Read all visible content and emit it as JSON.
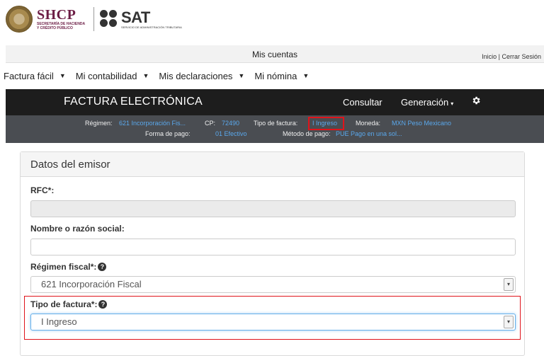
{
  "header": {
    "shcp_title": "SHCP",
    "shcp_subtitle_1": "SECRETARÍA DE HACIENDA",
    "shcp_subtitle_2": "Y CRÉDITO PÚBLICO",
    "sat_title": "SAT",
    "sat_subtitle": "SERVICIO DE ADMINISTRACIÓN TRIBUTARIA"
  },
  "topbar": {
    "title": "Mis cuentas",
    "inicio": "Inicio",
    "separator": "|",
    "cerrar": "Cerrar Sesión"
  },
  "menu": {
    "items": [
      {
        "label": "Factura fácil"
      },
      {
        "label": "Mi contabilidad"
      },
      {
        "label": "Mis declaraciones"
      },
      {
        "label": "Mi nómina"
      }
    ],
    "caret": "▼"
  },
  "factura_bar": {
    "title": "FACTURA ELECTRÓNICA",
    "consultar": "Consultar",
    "generacion": "Generación",
    "caret": "▾",
    "gear_icon": "gear-icon"
  },
  "info_bar": {
    "regimen_label": "Régimen:",
    "regimen_value": "621 Incorporación Fis...",
    "cp_label": "CP:",
    "cp_value": "72490",
    "tipo_label": "Tipo de factura:",
    "tipo_value": "I Ingreso",
    "moneda_label": "Moneda:",
    "moneda_value": "MXN Peso Mexicano",
    "forma_label": "Forma de pago:",
    "forma_value": "01 Efectivo",
    "metodo_label": "Método de pago:",
    "metodo_value": "PUE Pago en una sol..."
  },
  "panel": {
    "title": "Datos del emisor",
    "rfc_label": "RFC*:",
    "rfc_value": "",
    "nombre_label": "Nombre o razón social:",
    "nombre_value": "",
    "regimen_label": "Régimen fiscal*:",
    "regimen_value": "621 Incorporación Fiscal",
    "tipo_label": "Tipo de factura*:",
    "tipo_value": "I Ingreso",
    "help_glyph": "?",
    "select_arrow": "▾"
  },
  "colors": {
    "brand_shcp": "#6c1d45",
    "dark_bar": "#1d1d1d",
    "info_bar": "#4a4d52",
    "link_blue": "#5aa8ec",
    "highlight_red": "#e0141b"
  }
}
